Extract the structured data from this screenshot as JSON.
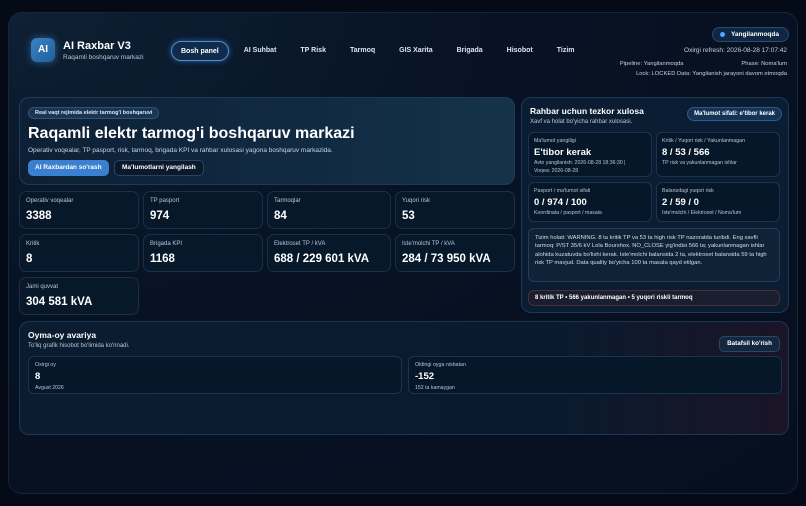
{
  "header": {
    "logo_text": "AI",
    "app_title": "AI Raxbar V3",
    "app_subtitle": "Raqamli boshqaruv markazi",
    "nav": [
      "Bosh panel",
      "AI Suhbat",
      "TP Risk",
      "Tarmoq",
      "GIS Xarita",
      "Brigada",
      "Hisobot",
      "Tizim"
    ],
    "active_nav": "Bosh panel",
    "status": "Yangilanmoqda",
    "refresh": "Oxirgi refresh: 2026-08-28 17:07:42",
    "meta_line1": "Pipeline: Yangilanmoqda                                    Phase: Noma'lum",
    "meta_line2": "Lock: LOCKED    Data: Yangilanish jarayoni davom etmoqda"
  },
  "hero": {
    "badge": "Real vaqt rejimida elektr tarmog'i boshqaruvi",
    "title": "Raqamli elektr tarmog'i boshqaruv markazi",
    "description": "Operativ voqealar, TP pasport, risk, tarmoq, brigada KPI va rahbar xulosasi yagona boshqaruv markazida.",
    "primary_button": "AI Raxbardan so'rash",
    "secondary_button": "Ma'lumotlarni yangilash"
  },
  "stats": [
    {
      "label": "Operativ voqealar",
      "value": "3388"
    },
    {
      "label": "TP pasport",
      "value": "974"
    },
    {
      "label": "Tarmoqlar",
      "value": "84"
    },
    {
      "label": "Yuqori risk",
      "value": "53"
    },
    {
      "label": "Kritik",
      "value": "8"
    },
    {
      "label": "Brigada KPI",
      "value": "1168"
    },
    {
      "label": "Elektroset TP / kVA",
      "value": "688 / 229 601 kVA"
    },
    {
      "label": "Iste'molchi TP / kVA",
      "value": "284 / 73 950 kVA"
    },
    {
      "label": "Jami quvvat",
      "value": "304 581 kVA"
    }
  ],
  "summary": {
    "title": "Rahbar uchun tezkor xulosa",
    "subtitle": "Xavf va holat bo'yicha rahbar xulosasi.",
    "quality_badge": "Ma'lumot sifati: e'tibor kerak",
    "cards": [
      {
        "label": "Ma'lumot yangiligi",
        "value": "E'tibor kerak",
        "note1": "Avto yangilanish: 2026-08-28 18:36:30 |",
        "note2": "Voqea: 2026-08-28"
      },
      {
        "label": "Kritik / Yuqori risk / Yakunlanmagan",
        "value": "8 / 53 / 566",
        "note1": "TP risk va yakunlanmagan ishlar",
        "note2": ""
      },
      {
        "label": "Pasport / ma'lumot sifati",
        "value": "0 / 974 / 100",
        "note1": "Koordinata / pasport / masala",
        "note2": ""
      },
      {
        "label": "Balansdagi yuqori risk",
        "value": "2 / 59 / 0",
        "note1": "Iste'molchi / Elektroset / Noma'lum",
        "note2": ""
      }
    ],
    "text": "Tizim holati: WARNING. 8 ta kritik TP va 53 ta high risk TP nazoratda turibdi. Eng xavfli tarmoq: P/ST 35/6 kV Lola Bourshox. NO_CLOSE yig'indisi 566 ta; yakunlanmagan ishlar alohida kuzatuvda bo'lishi kerak. Iste'molchi balansida 2 ta, elektroset balansida 59 ta high risk TP mavjud. Data quality bo'yicha 100 ta masala qayd etilgan.",
    "footer": "8 kritik TP • 566 yakunlanmagan • 5 yuqori riskli tarmoq"
  },
  "monthly": {
    "title": "Oyma-oy avariya",
    "subtitle": "To'liq grafik hisobot bo'limida ko'rinadi.",
    "button": "Batafsil ko'rish",
    "cards": [
      {
        "label": "Oxirgi oy",
        "value": "8",
        "note": "Avgust 2026"
      },
      {
        "label": "Oldingi oyga nisbatan",
        "value": "-152",
        "note": "152 ta kamaygan"
      }
    ]
  },
  "icons": {
    "status_dot": "status-dot-icon"
  },
  "colors": {
    "accent": "#3b7fd0",
    "background": "#040b17",
    "panel": "#0a1d33"
  }
}
